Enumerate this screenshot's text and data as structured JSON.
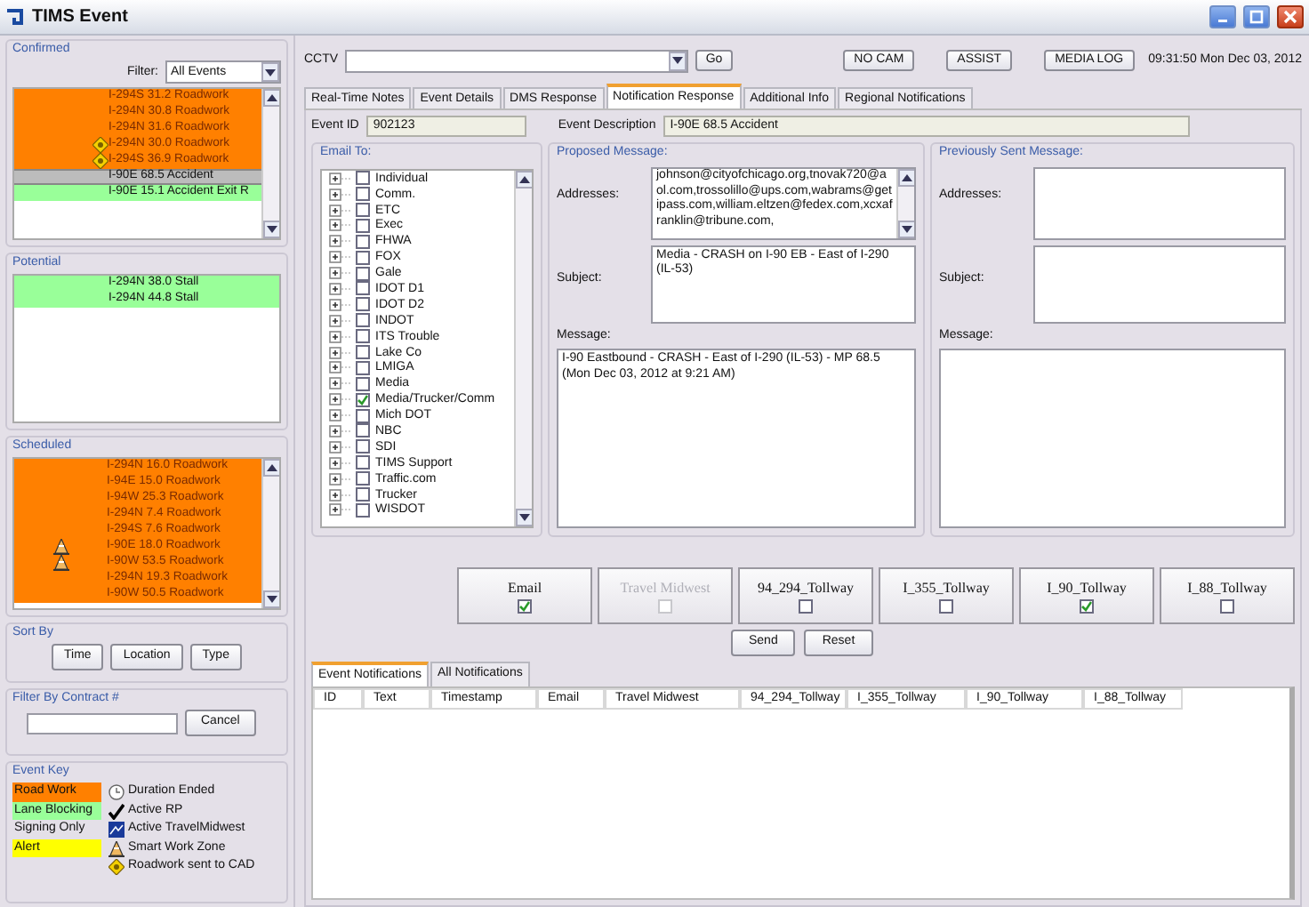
{
  "window": {
    "title": "TIMS Event"
  },
  "confirmed": {
    "title": "Confirmed",
    "filter_label": "Filter:",
    "filter_value": "All Events",
    "rows": [
      {
        "text": "I-294S 31.2 Roadwork",
        "color": "#ff8000",
        "cad": false,
        "selected": false
      },
      {
        "text": "I-294N 30.8 Roadwork",
        "color": "#ff8000",
        "cad": false,
        "selected": false
      },
      {
        "text": "I-294N 31.6 Roadwork",
        "color": "#ff8000",
        "cad": false,
        "selected": false
      },
      {
        "text": "I-294N 30.0 Roadwork",
        "color": "#ff8000",
        "cad": true,
        "selected": false
      },
      {
        "text": "I-294S 36.9 Roadwork",
        "color": "#ff8000",
        "cad": true,
        "selected": false
      },
      {
        "text": "I-90E 68.5 Accident",
        "color": "#bcbcbc",
        "cad": false,
        "selected": true
      },
      {
        "text": "I-90E 15.1 Accident Exit R",
        "color": "#99ff99",
        "cad": false,
        "selected": false
      }
    ]
  },
  "potential": {
    "title": "Potential",
    "rows": [
      {
        "text": "I-294N 38.0 Stall",
        "color": "#99ff99"
      },
      {
        "text": "I-294N 44.8 Stall",
        "color": "#99ff99"
      }
    ]
  },
  "scheduled": {
    "title": "Scheduled",
    "rows": [
      {
        "text": "I-294N 16.0 Roadwork",
        "color": "#ff8000",
        "work_zone": false
      },
      {
        "text": "I-94E 15.0 Roadwork",
        "color": "#ff8000",
        "work_zone": false
      },
      {
        "text": "I-94W 25.3 Roadwork",
        "color": "#ff8000",
        "work_zone": false
      },
      {
        "text": "I-294N 7.4 Roadwork",
        "color": "#ff8000",
        "work_zone": false
      },
      {
        "text": "I-294S 7.6 Roadwork",
        "color": "#ff8000",
        "work_zone": false
      },
      {
        "text": "I-90E 18.0 Roadwork",
        "color": "#ff8000",
        "work_zone": true
      },
      {
        "text": "I-90W 53.5 Roadwork",
        "color": "#ff8000",
        "work_zone": true
      },
      {
        "text": "I-294N 19.3 Roadwork",
        "color": "#ff8000",
        "work_zone": false
      },
      {
        "text": "I-90W 50.5 Roadwork",
        "color": "#ff8000",
        "work_zone": false
      }
    ]
  },
  "sort_by": {
    "title": "Sort By",
    "buttons": [
      "Time",
      "Location",
      "Type"
    ]
  },
  "contract_filter": {
    "title": "Filter By Contract #",
    "button": "Cancel"
  },
  "event_key": {
    "title": "Event Key",
    "swatches": [
      {
        "label": "Road Work",
        "color": "#ff8000"
      },
      {
        "label": "Lane Blocking",
        "color": "#99ff99"
      },
      {
        "label": "Signing Only"
      },
      {
        "label": "Alert",
        "color": "#ffff00"
      }
    ],
    "icons": [
      {
        "kind": "clock",
        "label": "Duration Ended"
      },
      {
        "kind": "check",
        "label": "Active RP"
      },
      {
        "kind": "travel",
        "label": "Active TravelMidwest"
      },
      {
        "kind": "cone",
        "label": "Smart Work Zone"
      },
      {
        "kind": "cad",
        "label": "Roadwork sent to CAD"
      }
    ]
  },
  "toolbar": {
    "cctv_label": "CCTV",
    "go": "Go",
    "buttons": [
      "NO CAM",
      "ASSIST",
      "MEDIA LOG"
    ],
    "datetime": "09:31:50 Mon Dec 03, 2012"
  },
  "tabs": [
    {
      "label": "Real-Time Notes",
      "selected": false
    },
    {
      "label": "Event Details",
      "selected": false
    },
    {
      "label": "DMS Response",
      "selected": false
    },
    {
      "label": "Notification Response",
      "selected": true
    },
    {
      "label": "Additional Info",
      "selected": false
    },
    {
      "label": "Regional Notifications",
      "selected": false
    }
  ],
  "event": {
    "id_label": "Event ID",
    "id": "902123",
    "desc_label": "Event Description",
    "desc": "I-90E 68.5 Accident"
  },
  "email_to": {
    "title": "Email To:",
    "items": [
      {
        "label": "Individual",
        "checked": false
      },
      {
        "label": "Comm.",
        "checked": false
      },
      {
        "label": "ETC",
        "checked": false
      },
      {
        "label": "Exec",
        "checked": false
      },
      {
        "label": "FHWA",
        "checked": false
      },
      {
        "label": "FOX",
        "checked": false
      },
      {
        "label": "Gale",
        "checked": false
      },
      {
        "label": "IDOT D1",
        "checked": false
      },
      {
        "label": "IDOT D2",
        "checked": false
      },
      {
        "label": "INDOT",
        "checked": false
      },
      {
        "label": "ITS Trouble",
        "checked": false
      },
      {
        "label": "Lake Co",
        "checked": false
      },
      {
        "label": "LMIGA",
        "checked": false
      },
      {
        "label": "Media",
        "checked": false
      },
      {
        "label": "Media/Trucker/Comm",
        "checked": true
      },
      {
        "label": "Mich DOT",
        "checked": false
      },
      {
        "label": "NBC",
        "checked": false
      },
      {
        "label": "SDI",
        "checked": false
      },
      {
        "label": "TIMS Support",
        "checked": false
      },
      {
        "label": "Traffic.com",
        "checked": false
      },
      {
        "label": "Trucker",
        "checked": false
      },
      {
        "label": "WISDOT",
        "checked": false
      }
    ]
  },
  "proposed": {
    "title": "Proposed Message:",
    "addresses_label": "Addresses:",
    "addresses": "johnson@cityofchicago.org,tnovak720@aol.com,trossolillo@ups.com,wabrams@getipass.com,william.eltzen@fedex.com,xcxafranklin@tribune.com,",
    "subject_label": "Subject:",
    "subject": "Media - CRASH on I-90 EB - East of I-290 (IL-53)",
    "message_label": "Message:",
    "message": "I-90 Eastbound - CRASH - East of I-290 (IL-53) - MP 68.5 (Mon Dec 03, 2012 at 9:21 AM)"
  },
  "previous": {
    "title": "Previously Sent Message:",
    "addresses_label": "Addresses:",
    "subject_label": "Subject:",
    "message_label": "Message:"
  },
  "channels": [
    {
      "label": "Email",
      "checked": true,
      "disabled": false
    },
    {
      "label": "Travel Midwest",
      "checked": false,
      "disabled": true
    },
    {
      "label": "94_294_Tollway",
      "checked": false,
      "disabled": false
    },
    {
      "label": "I_355_Tollway",
      "checked": false,
      "disabled": false
    },
    {
      "label": "I_90_Tollway",
      "checked": true,
      "disabled": false
    },
    {
      "label": "I_88_Tollway",
      "checked": false,
      "disabled": false
    }
  ],
  "actions": [
    "Send",
    "Reset"
  ],
  "notification_tabs": [
    {
      "label": "Event Notifications",
      "selected": true
    },
    {
      "label": "All Notifications",
      "selected": false
    }
  ],
  "table": {
    "columns": [
      "ID",
      "Text",
      "Timestamp",
      "Email",
      "Travel Midwest",
      "94_294_Tollway",
      "I_355_Tollway",
      "I_90_Tollway",
      "I_88_Tollway"
    ]
  }
}
